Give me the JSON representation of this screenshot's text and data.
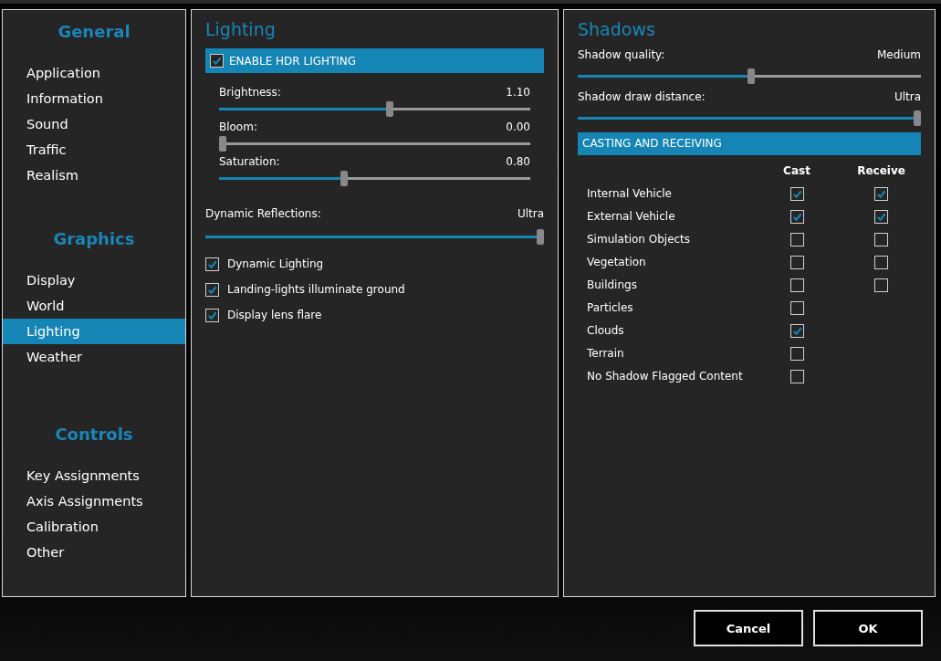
{
  "sidebar": {
    "sections": [
      {
        "heading": "General",
        "items": [
          {
            "label": "Application",
            "selected": false
          },
          {
            "label": "Information",
            "selected": false
          },
          {
            "label": "Sound",
            "selected": false
          },
          {
            "label": "Traffic",
            "selected": false
          },
          {
            "label": "Realism",
            "selected": false
          }
        ]
      },
      {
        "heading": "Graphics",
        "items": [
          {
            "label": "Display",
            "selected": false
          },
          {
            "label": "World",
            "selected": false
          },
          {
            "label": "Lighting",
            "selected": true
          },
          {
            "label": "Weather",
            "selected": false
          }
        ]
      },
      {
        "heading": "Controls",
        "items": [
          {
            "label": "Key Assignments",
            "selected": false
          },
          {
            "label": "Axis Assignments",
            "selected": false
          },
          {
            "label": "Calibration",
            "selected": false
          },
          {
            "label": "Other",
            "selected": false
          }
        ]
      }
    ]
  },
  "lighting": {
    "title": "Lighting",
    "hdr": {
      "label": "ENABLE HDR LIGHTING",
      "checked": true
    },
    "hdr_sliders": [
      {
        "label": "Brightness:",
        "reading": "1.10",
        "level": 0.55
      },
      {
        "label": "Bloom:",
        "reading": "0.00",
        "level": 0
      },
      {
        "label": "Saturation:",
        "reading": "0.80",
        "level": 0.4
      }
    ],
    "reflections": {
      "label": "Dynamic Reflections:",
      "reading": "Ultra",
      "level": 1
    },
    "options": [
      {
        "label": "Dynamic Lighting",
        "checked": true
      },
      {
        "label": "Landing-lights illuminate ground",
        "checked": true
      },
      {
        "label": "Display lens flare",
        "checked": true
      }
    ]
  },
  "shadows": {
    "title": "Shadows",
    "sliders": [
      {
        "label": "Shadow quality:",
        "reading": "Medium",
        "level": 0.505
      },
      {
        "label": "Shadow draw distance:",
        "reading": "Ultra",
        "level": 1
      }
    ],
    "section": "CASTING AND RECEIVING",
    "columns": [
      "Cast",
      "Receive"
    ],
    "rows": [
      {
        "label": "Internal Vehicle",
        "cast": true,
        "receive": true
      },
      {
        "label": "External Vehicle",
        "cast": true,
        "receive": true
      },
      {
        "label": "Simulation Objects",
        "cast": false,
        "receive": false
      },
      {
        "label": "Vegetation",
        "cast": false,
        "receive": false
      },
      {
        "label": "Buildings",
        "cast": false,
        "receive": false
      },
      {
        "label": "Particles",
        "cast": false
      },
      {
        "label": "Clouds",
        "cast": true
      },
      {
        "label": "Terrain",
        "cast": false
      },
      {
        "label": "No Shadow Flagged Content",
        "cast": false
      }
    ]
  },
  "buttons": [
    "Cancel",
    "OK"
  ]
}
